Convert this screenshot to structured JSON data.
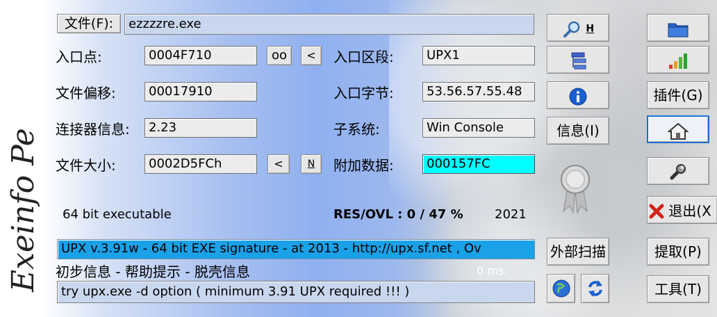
{
  "signature_text": "Exeinfo Pe",
  "file": {
    "label": "文件(F):",
    "value": "ezzzzre.exe"
  },
  "entry_point": {
    "label": "入口点:",
    "value": "0004F710",
    "btn_oo": "oo",
    "btn_lt": "<"
  },
  "entry_section": {
    "label": "入口区段:",
    "value": "UPX1"
  },
  "file_offset": {
    "label": "文件偏移:",
    "value": "00017910"
  },
  "entry_bytes": {
    "label": "入口字节:",
    "value": "53.56.57.55.48"
  },
  "linker_info": {
    "label": "连接器信息:",
    "value": "2.23"
  },
  "subsystem": {
    "label": "子系统:",
    "value": "Win Console"
  },
  "file_size": {
    "label": "文件大小:",
    "value": "0002D5FCh",
    "btn_lt": "<",
    "btn_n": "N"
  },
  "overlay": {
    "label": "附加数据:",
    "value": "000157FC"
  },
  "status": {
    "arch": "64 bit executable",
    "res_ovl": "RES/OVL : 0 / 47 %",
    "year": "2021"
  },
  "detection": "UPX v.3.91w - 64 bit EXE signature  - at  2013 - http://upx.sf.net , Ov",
  "hint_title": "初步信息 - 帮助提示 - 脱壳信息",
  "timing": "0 ms.",
  "hint": "try upx.exe -d option ( minimum 3.91 UPX required !!! )",
  "buttons": {
    "search_h": "H",
    "info": "信息(I)",
    "external_scan": "外部扫描",
    "plugins": "插件(G)",
    "exit": "退出(X",
    "extract": "提取(P)",
    "tools": "工具(T)"
  },
  "colors": {
    "accent": "#1f6fd0",
    "overlay": "#00ffff",
    "selection": "#1aa1e8"
  }
}
